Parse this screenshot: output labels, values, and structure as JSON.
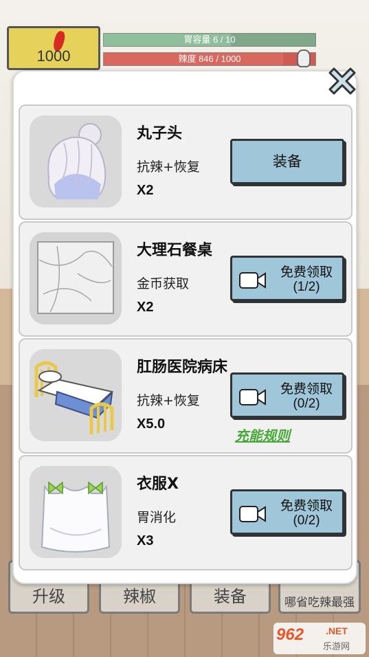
{
  "hud": {
    "coins": "1000",
    "stomach_label": "胃容量 6 / 10",
    "stomach_fraction": 0.6,
    "spicy_label": "辣度 846 / 1000",
    "spicy_fraction": 0.846
  },
  "background_buttons": [
    "升级",
    "辣椒",
    "装备",
    "哪省吃辣最强"
  ],
  "modal": {
    "items": [
      {
        "name": "丸子头",
        "effect": "抗辣+恢复",
        "multiplier": "X2",
        "button": {
          "type": "equip",
          "label": "装备"
        },
        "icon": "hair-bun-icon"
      },
      {
        "name": "大理石餐桌",
        "effect": "金币获取",
        "multiplier": "X2",
        "button": {
          "type": "video",
          "label": "免费领取",
          "progress": "(1/2)"
        },
        "icon": "marble-table-icon"
      },
      {
        "name": "肛肠医院病床",
        "effect": "抗辣+恢复",
        "multiplier": "X5.0",
        "button": {
          "type": "video",
          "label": "免费领取",
          "progress": "(0/2)"
        },
        "icon": "hospital-bed-icon"
      },
      {
        "name": "衣服X",
        "effect": "胃消化",
        "multiplier": "X3",
        "button": {
          "type": "video",
          "label": "免费领取",
          "progress": "(0/2)"
        },
        "icon": "white-shirt-icon"
      }
    ],
    "charge_rule_link": "充能规则"
  },
  "watermark": {
    "logo": "962",
    "net": ".NET",
    "site": "乐游网"
  },
  "colors": {
    "button_fill": "#9fc6d9",
    "rule_link": "#49a83a",
    "coin_panel": "#e6d25a"
  }
}
